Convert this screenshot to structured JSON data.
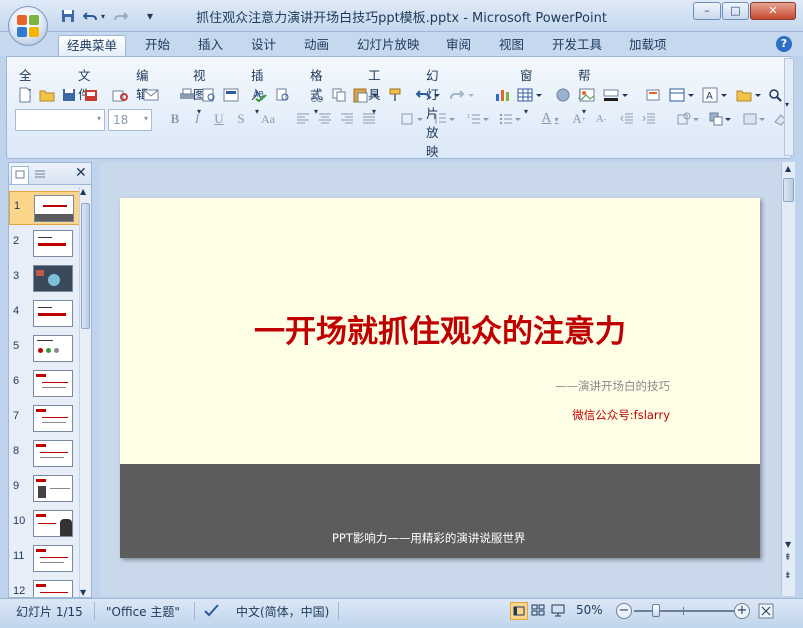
{
  "window": {
    "title": "抓住观众注意力演讲开场白技巧ppt模板.pptx - Microsoft PowerPoint",
    "minimize": "–",
    "maximize": "□",
    "close": "✕"
  },
  "quick_access": {
    "save_icon": "save-icon",
    "undo_icon": "undo-icon",
    "redo_icon": "redo-icon",
    "customize": "▾"
  },
  "tabs": [
    "经典菜单",
    "开始",
    "插入",
    "设计",
    "动画",
    "幻灯片放映",
    "审阅",
    "视图",
    "开发工具",
    "加载项"
  ],
  "help_icon": "?",
  "menus": [
    "全部",
    "文件",
    "编辑",
    "视图",
    "插入",
    "格式",
    "工具",
    "幻灯片放映",
    "窗口",
    "帮助"
  ],
  "format": {
    "font_name": "",
    "font_size": "18",
    "bold": "B",
    "italic": "I",
    "underline": "U",
    "shadow": "S",
    "case": "Aa",
    "font_color": "A",
    "grow": "A",
    "shrink": "A"
  },
  "slides_panel": {
    "numbers": [
      "1",
      "2",
      "3",
      "4",
      "5",
      "6",
      "7",
      "8",
      "9",
      "10",
      "11",
      "12"
    ],
    "selected": 1
  },
  "slide": {
    "title": "一开场就抓住观众的注意力",
    "subtitle": "——演讲开场白的技巧",
    "wechat": "微信公众号:fslarry",
    "footer": "PPT影响力——用精彩的演讲说服世界"
  },
  "status": {
    "slide_info": "幻灯片 1/15",
    "theme": "\"Office 主题\"",
    "language": "中文(简体，中国)",
    "zoom": "50%"
  },
  "colors": {
    "slide_bg": "#fefee6",
    "title_red": "#c00000",
    "band_gray": "#5c5c5c",
    "selected_thumb": "#fbd58a"
  }
}
